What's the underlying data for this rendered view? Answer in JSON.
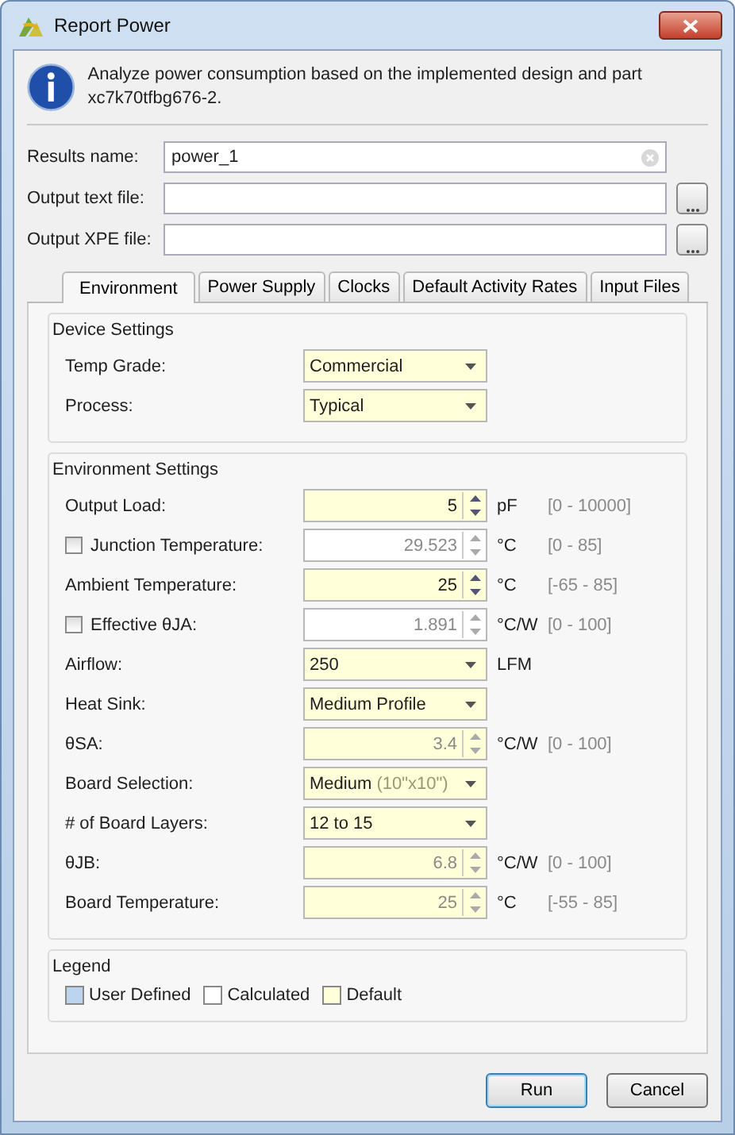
{
  "window": {
    "title": "Report Power"
  },
  "info": {
    "text": "Analyze power consumption based on the implemented design and part xc7k70tfbg676-2."
  },
  "files": [
    {
      "label": "Results name:",
      "value": "power_1",
      "kind": "clearable"
    },
    {
      "label": "Output text file:",
      "kind": "browse"
    },
    {
      "label": "Output XPE file:",
      "kind": "browse"
    }
  ],
  "tabs": [
    {
      "label": "Environment",
      "selected": true
    },
    {
      "label": "Power Supply",
      "selected": false
    },
    {
      "label": "Clocks",
      "selected": false
    },
    {
      "label": "Default Activity Rates",
      "selected": false
    },
    {
      "label": "Input Files",
      "selected": false
    }
  ],
  "device_settings": {
    "title": "Device Settings",
    "rows": [
      {
        "label": "Temp Grade:",
        "kind": "combo",
        "value": "Commercial",
        "color": "#ffffd9"
      },
      {
        "label": "Process:",
        "kind": "combo",
        "value": "Typical",
        "color": "#ffffd9"
      }
    ]
  },
  "environment_settings": {
    "title": "Environment Settings",
    "rows": [
      {
        "label": "Output Load:",
        "kind": "spin",
        "value": "5",
        "color": "#ffffd9",
        "disabled": false,
        "unit": "pF",
        "range": "[0 - 10000]"
      },
      {
        "label": "Junction Temperature:",
        "kind": "check-spin",
        "checked": false,
        "value": "29.523",
        "color": "#ffffff",
        "disabled": true,
        "unit": "°C",
        "range": "[0 - 85]"
      },
      {
        "label": "Ambient Temperature:",
        "kind": "spin",
        "value": "25",
        "color": "#ffffd9",
        "disabled": false,
        "unit": "°C",
        "range": "[-65 - 85]"
      },
      {
        "label": "Effective θJA:",
        "kind": "check-spin",
        "checked": false,
        "value": "1.891",
        "color": "#ffffff",
        "disabled": true,
        "unit": "°C/W",
        "range": "[0 - 100]"
      },
      {
        "label": "Airflow:",
        "kind": "combo",
        "value": "250",
        "color": "#ffffd9",
        "unit": "LFM"
      },
      {
        "label": "Heat Sink:",
        "kind": "combo",
        "value": "Medium Profile",
        "color": "#ffffd9"
      },
      {
        "label": "θSA:",
        "kind": "spin",
        "value": "3.4",
        "color": "#ffffd9",
        "disabled": true,
        "unit": "°C/W",
        "range": "[0 - 100]"
      },
      {
        "label": "Board Selection:",
        "kind": "combo",
        "value": "Medium",
        "detail": "(10\"x10\")",
        "color": "#ffffd9"
      },
      {
        "label": "# of Board Layers:",
        "kind": "combo",
        "value": "12 to 15",
        "color": "#ffffd9"
      },
      {
        "label": "θJB:",
        "kind": "spin",
        "value": "6.8",
        "color": "#ffffd9",
        "disabled": true,
        "unit": "°C/W",
        "range": "[0 - 100]"
      },
      {
        "label": "Board Temperature:",
        "kind": "spin",
        "value": "25",
        "color": "#ffffd9",
        "disabled": true,
        "unit": "°C",
        "range": "[-55 - 85]"
      }
    ]
  },
  "legend": {
    "title": "Legend",
    "items": [
      {
        "label": "User Defined",
        "color": "#bcd4ee"
      },
      {
        "label": "Calculated",
        "color": "#ffffff"
      },
      {
        "label": "Default",
        "color": "#ffffd9"
      }
    ]
  },
  "buttons": [
    {
      "label": "Run",
      "default": true
    },
    {
      "label": "Cancel",
      "default": false
    }
  ]
}
